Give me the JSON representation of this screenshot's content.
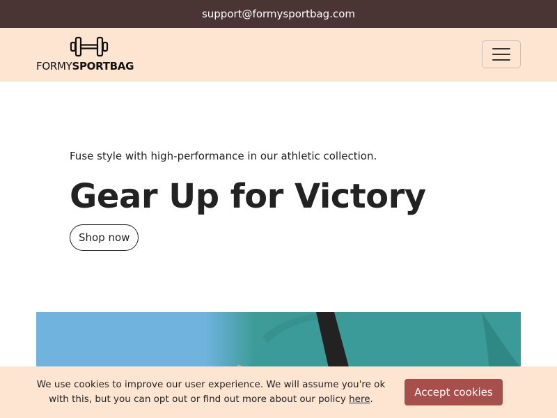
{
  "topbar": {
    "email": "support@formysportbag.com"
  },
  "logo": {
    "text_light": "FORMY",
    "text_bold": "SPORTBAG",
    "icon": "dumbbell-icon"
  },
  "navbar": {
    "menu_icon": "hamburger-icon"
  },
  "hero": {
    "subtitle": "Fuse style with high-performance in our athletic collection.",
    "title": "Gear Up for Victory",
    "cta_label": "Shop now"
  },
  "cookie_banner": {
    "text_before": "We use cookies to improve our user experience. We will assume you're ok with this, but you can opt out or find out more about our policy ",
    "link_label": "here",
    "text_after": ".",
    "accept_label": "Accept cookies"
  },
  "colors": {
    "topbar_bg": "#4a3434",
    "navbar_bg": "#fde5d2",
    "accept_button": "#a84f4c"
  }
}
